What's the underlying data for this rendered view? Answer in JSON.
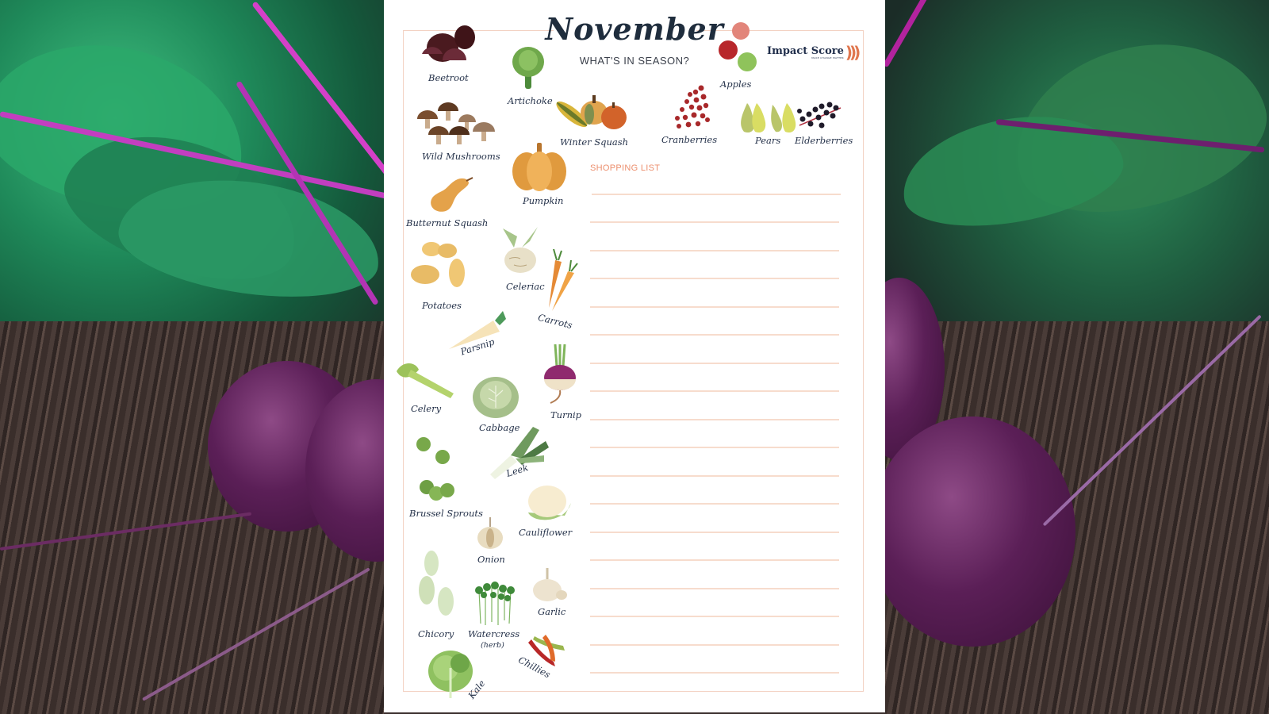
{
  "header": {
    "title": "November",
    "subtitle": "WHAT'S IN SEASON?"
  },
  "logo": {
    "name": "Impact Score",
    "tagline": "MAKE CHANGE MATTER",
    "waves": ")))"
  },
  "shopping_list": {
    "label": "SHOPPING LIST",
    "line_count": 18
  },
  "produce": [
    {
      "id": "beetroot",
      "label": "Beetroot",
      "icon": "beetroot-icon"
    },
    {
      "id": "artichoke",
      "label": "Artichoke",
      "icon": "artichoke-icon"
    },
    {
      "id": "apples",
      "label": "Apples",
      "icon": "apples-icon"
    },
    {
      "id": "wild-mushrooms",
      "label": "Wild Mushrooms",
      "icon": "mushrooms-icon"
    },
    {
      "id": "winter-squash",
      "label": "Winter Squash",
      "icon": "winter-squash-icon"
    },
    {
      "id": "cranberries",
      "label": "Cranberries",
      "icon": "cranberries-icon"
    },
    {
      "id": "pears",
      "label": "Pears",
      "icon": "pears-icon"
    },
    {
      "id": "elderberries",
      "label": "Elderberries",
      "icon": "elderberries-icon"
    },
    {
      "id": "pumpkin",
      "label": "Pumpkin",
      "icon": "pumpkin-icon"
    },
    {
      "id": "butternut-squash",
      "label": "Butternut  Squash",
      "icon": "butternut-squash-icon"
    },
    {
      "id": "celeriac",
      "label": "Celeriac",
      "icon": "celeriac-icon"
    },
    {
      "id": "potatoes",
      "label": "Potatoes",
      "icon": "potatoes-icon"
    },
    {
      "id": "carrots",
      "label": "Carrots",
      "icon": "carrots-icon"
    },
    {
      "id": "parsnip",
      "label": "Parsnip",
      "icon": "parsnip-icon"
    },
    {
      "id": "celery",
      "label": "Celery",
      "icon": "celery-icon"
    },
    {
      "id": "cabbage",
      "label": "Cabbage",
      "icon": "cabbage-icon"
    },
    {
      "id": "turnip",
      "label": "Turnip",
      "icon": "turnip-icon"
    },
    {
      "id": "leek",
      "label": "Leek",
      "icon": "leek-icon"
    },
    {
      "id": "brussel-sprouts",
      "label": "Brussel Sprouts",
      "icon": "brussel-sprouts-icon"
    },
    {
      "id": "cauliflower",
      "label": "Cauliflower",
      "icon": "cauliflower-icon"
    },
    {
      "id": "onion",
      "label": "Onion",
      "icon": "onion-icon"
    },
    {
      "id": "garlic",
      "label": "Garlic",
      "icon": "garlic-icon"
    },
    {
      "id": "chicory",
      "label": "Chicory",
      "icon": "chicory-icon"
    },
    {
      "id": "watercress",
      "label": "Watercress",
      "sublabel": "(herb)",
      "icon": "watercress-icon"
    },
    {
      "id": "chillies",
      "label": "Chillies",
      "icon": "chillies-icon"
    },
    {
      "id": "kale",
      "label": "Kale",
      "icon": "kale-icon"
    }
  ],
  "colors": {
    "frame": "#f3d2c3",
    "accent": "#ec8f6e",
    "title_text": "#1f2d3d",
    "label_text": "#25324a",
    "list_lines": "#f7dccd"
  }
}
